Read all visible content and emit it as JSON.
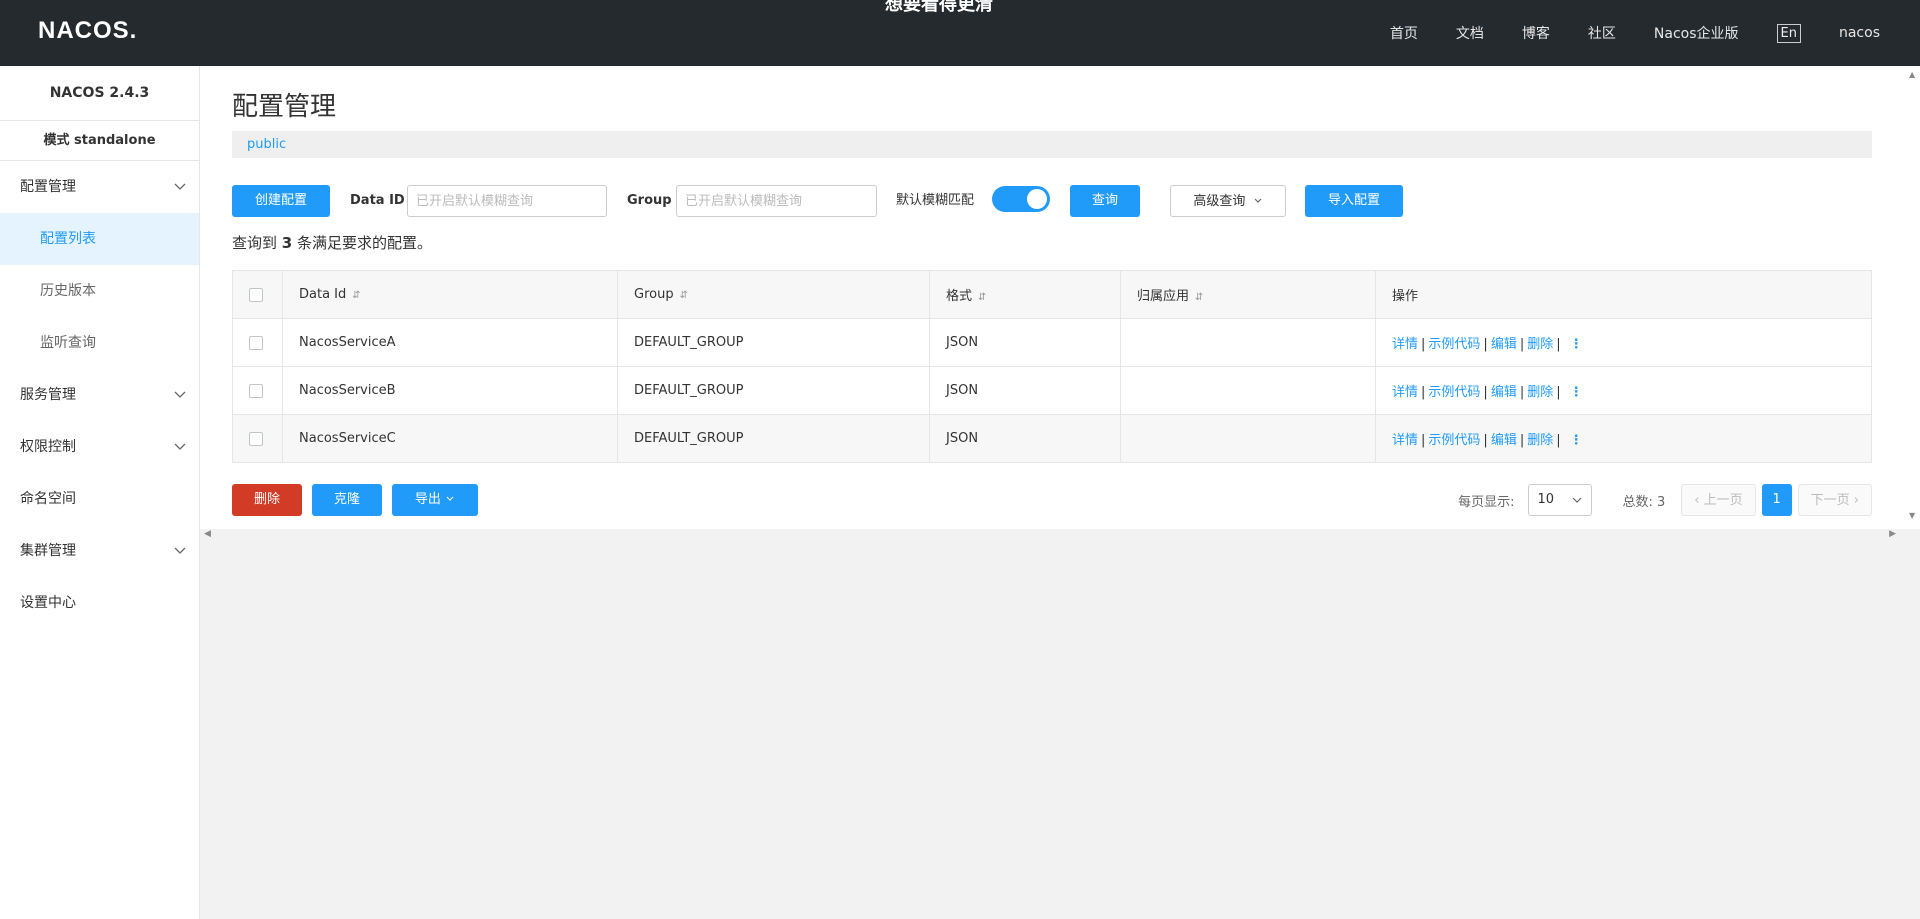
{
  "header": {
    "logo": "NACOS.",
    "cut_title": "想要看得更清",
    "nav": [
      "首页",
      "文档",
      "博客",
      "社区",
      "Nacos企业版"
    ],
    "lang": "En",
    "user": "nacos"
  },
  "sidebar": {
    "version": "NACOS 2.4.3",
    "mode": "模式 standalone",
    "items": [
      {
        "label": "配置管理"
      },
      {
        "label": "配置列表"
      },
      {
        "label": "历史版本"
      },
      {
        "label": "监听查询"
      },
      {
        "label": "服务管理"
      },
      {
        "label": "权限控制"
      },
      {
        "label": "命名空间"
      },
      {
        "label": "集群管理"
      },
      {
        "label": "设置中心"
      }
    ]
  },
  "main": {
    "title": "配置管理",
    "namespace": "public",
    "toolbar": {
      "create_label": "创建配置",
      "dataid_label": "Data ID",
      "dataid_placeholder": "已开启默认模糊查询",
      "group_label": "Group",
      "group_placeholder": "已开启默认模糊查询",
      "fuzzy_label": "默认模糊匹配",
      "fuzzy_on": true,
      "query_label": "查询",
      "advanced_label": "高级查询",
      "import_label": "导入配置"
    },
    "result": {
      "prefix": "查询到",
      "count": "3",
      "suffix": "条满足要求的配置。"
    },
    "table": {
      "headers": [
        "Data Id",
        "Group",
        "格式",
        "归属应用",
        "操作"
      ],
      "rows": [
        {
          "data_id": "NacosServiceA",
          "group": "DEFAULT_GROUP",
          "format": "JSON",
          "app": ""
        },
        {
          "data_id": "NacosServiceB",
          "group": "DEFAULT_GROUP",
          "format": "JSON",
          "app": ""
        },
        {
          "data_id": "NacosServiceC",
          "group": "DEFAULT_GROUP",
          "format": "JSON",
          "app": ""
        }
      ],
      "ops": {
        "detail": "详情",
        "sample": "示例代码",
        "edit": "编辑",
        "delete": "删除",
        "sep": "|"
      }
    },
    "footer": {
      "delete_label": "删除",
      "clone_label": "克隆",
      "export_label": "导出",
      "page_size_label": "每页显示:",
      "page_size": "10",
      "total_label": "总数: 3",
      "prev_label": "上一页",
      "current_page": "1",
      "next_label": "下一页"
    }
  },
  "colors": {
    "primary": "#209bfa",
    "danger": "#d23c26",
    "header_bg": "#252a2f"
  }
}
